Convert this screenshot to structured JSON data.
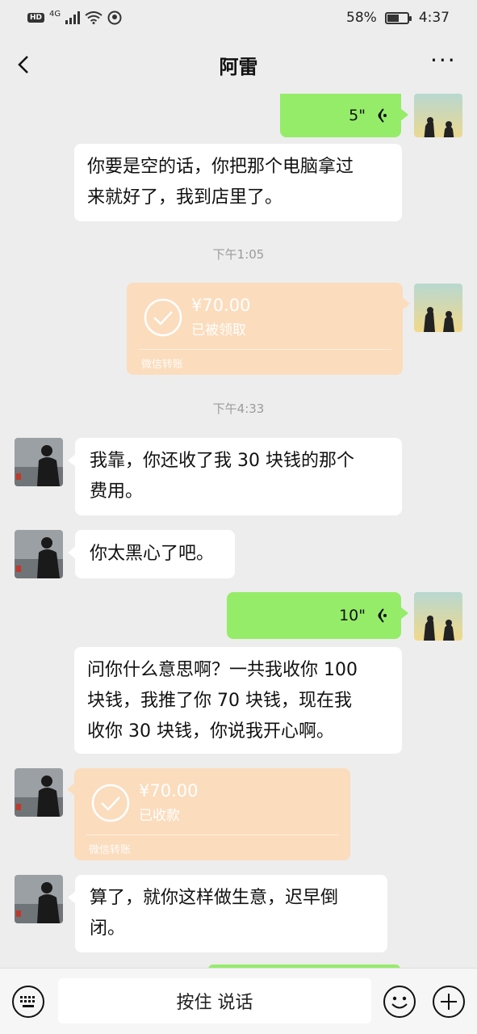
{
  "status_bar": {
    "hd": "HD",
    "network": "4G",
    "battery_pct": "58%",
    "battery_level": 0.58,
    "time": "4:37"
  },
  "nav": {
    "title": "阿雷",
    "more": "···"
  },
  "messages": [
    {
      "type": "voice",
      "from": "me",
      "duration": "5\""
    },
    {
      "type": "text",
      "from": "peer",
      "lines": [
        "你要是空的话，你把那个电脑拿过",
        "来就好了，我到店里了。"
      ]
    },
    {
      "type": "time",
      "text": "下午1:05"
    },
    {
      "type": "transfer",
      "from": "me",
      "amount": "¥70.00",
      "status": "已被领取",
      "footer": "微信转账"
    },
    {
      "type": "time",
      "text": "下午4:33"
    },
    {
      "type": "text",
      "from": "peer",
      "lines": [
        "我靠，你还收了我 30 块钱的那个",
        "费用。"
      ]
    },
    {
      "type": "text",
      "from": "peer",
      "lines": [
        "你太黑心了吧。"
      ]
    },
    {
      "type": "voice",
      "from": "me",
      "duration": "10\""
    },
    {
      "type": "text",
      "from": "me_caption",
      "lines": [
        "问你什么意思啊？一共我收你 100",
        "块钱，我推了你 70 块钱，现在我",
        "收你 30 块钱，你说我开心啊。"
      ]
    },
    {
      "type": "transfer",
      "from": "peer",
      "amount": "¥70.00",
      "status": "已收款",
      "footer": "微信转账"
    },
    {
      "type": "text",
      "from": "peer",
      "lines": [
        "算了，就你这样做生意，迟早倒",
        "闭。"
      ]
    }
  ],
  "input_bar": {
    "hold_to_talk": "按住 说话",
    "icons": [
      "keyboard-icon",
      "emoji-icon",
      "plus-icon"
    ]
  },
  "colors": {
    "background": "#ededed",
    "bubble_green": "#95ec69",
    "transfer_orange": "#fbdcbd",
    "bubble_white": "#ffffff"
  }
}
